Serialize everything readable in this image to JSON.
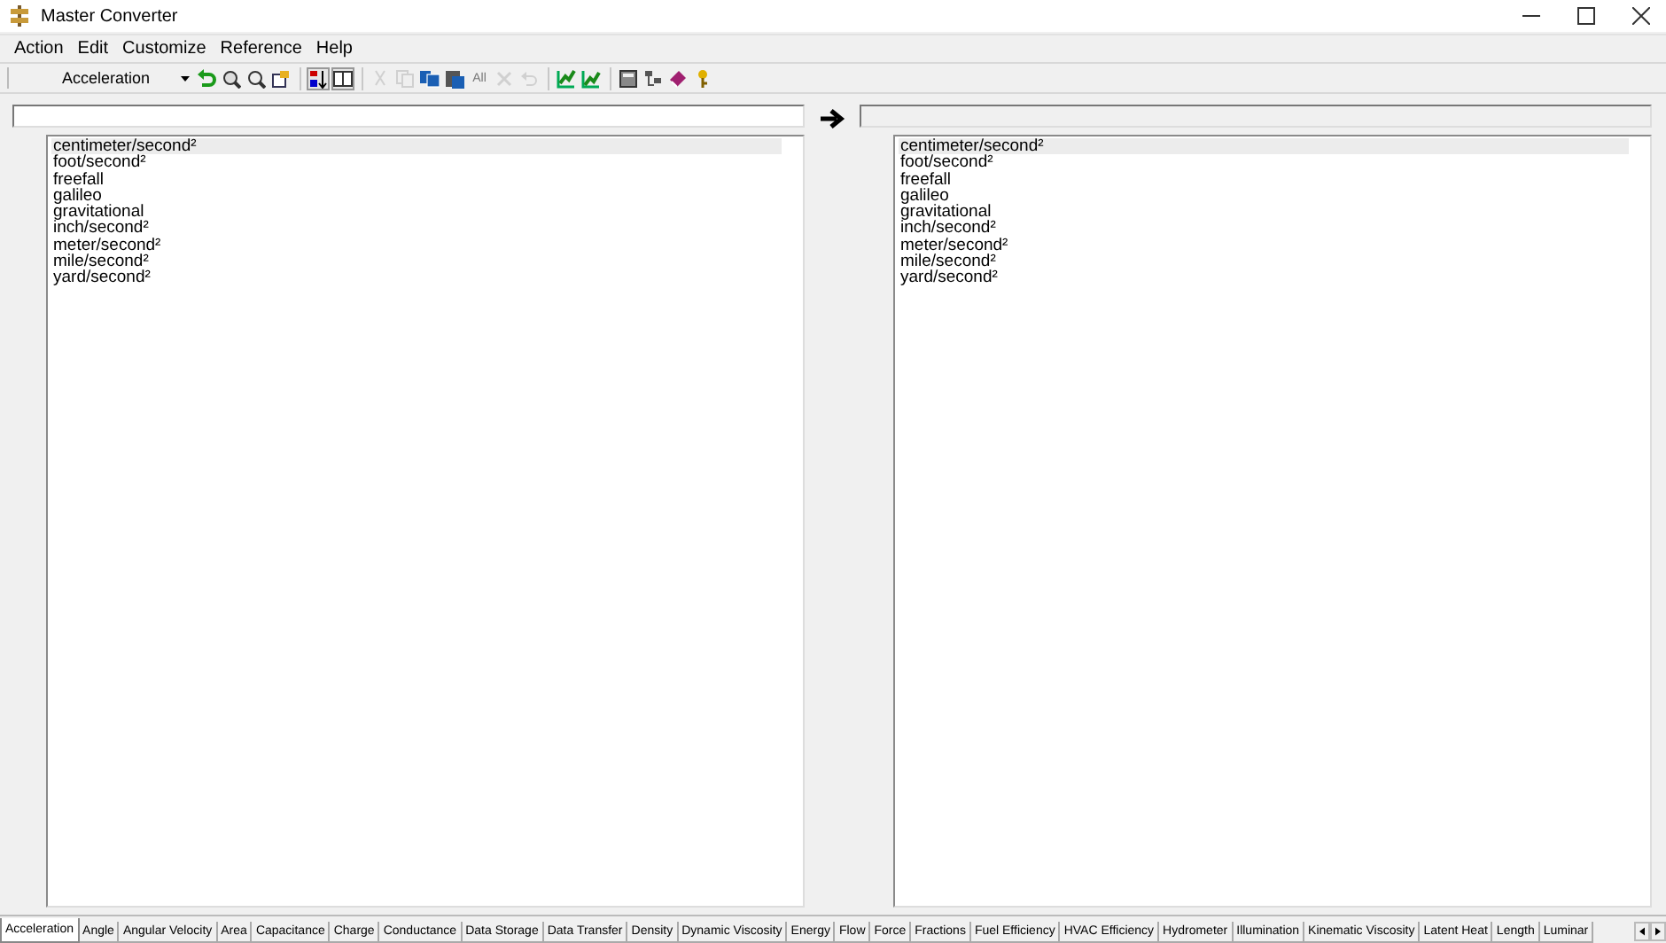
{
  "window": {
    "title": "Master Converter"
  },
  "menu": [
    "Action",
    "Edit",
    "Customize",
    "Reference",
    "Help"
  ],
  "toolbar": {
    "category": "Acceleration",
    "buttons": [
      {
        "disabled": false
      },
      {
        "disabled": false
      },
      {
        "disabled": false
      },
      {
        "disabled": false
      },
      {
        "disabled": false
      },
      {
        "disabled": false
      },
      {
        "disabled": true
      },
      {
        "disabled": true
      },
      {
        "disabled": false
      },
      {
        "disabled": false
      },
      {
        "label": "All",
        "disabled": true
      },
      {
        "disabled": true
      },
      {
        "disabled": true
      },
      {
        "disabled": false
      },
      {
        "disabled": false
      },
      {
        "disabled": false
      },
      {
        "disabled": false
      },
      {
        "disabled": false
      },
      {
        "disabled": false
      }
    ]
  },
  "from": {
    "disabled": false,
    "units": [
      {
        "label": "centimeter/second²",
        "selected": true
      },
      {
        "label": "foot/second²",
        "selected": false
      },
      {
        "label": "freefall",
        "selected": false
      },
      {
        "label": "galileo",
        "selected": false
      },
      {
        "label": "gravitational",
        "selected": false
      },
      {
        "label": "inch/second²",
        "selected": false
      },
      {
        "label": "meter/second²",
        "selected": false
      },
      {
        "label": "mile/second²",
        "selected": false
      },
      {
        "label": "yard/second²",
        "selected": false
      }
    ]
  },
  "to": {
    "disabled": true,
    "units": [
      {
        "label": "centimeter/second²",
        "selected": true
      },
      {
        "label": "foot/second²",
        "selected": false
      },
      {
        "label": "freefall",
        "selected": false
      },
      {
        "label": "galileo",
        "selected": false
      },
      {
        "label": "gravitational",
        "selected": false
      },
      {
        "label": "inch/second²",
        "selected": false
      },
      {
        "label": "meter/second²",
        "selected": false
      },
      {
        "label": "mile/second²",
        "selected": false
      },
      {
        "label": "yard/second²",
        "selected": false
      }
    ]
  },
  "tabs": [
    {
      "label": "Acceleration",
      "selected": true
    },
    {
      "label": "Angle",
      "selected": false
    },
    {
      "label": "Angular Velocity",
      "selected": false
    },
    {
      "label": "Area",
      "selected": false
    },
    {
      "label": "Capacitance",
      "selected": false
    },
    {
      "label": "Charge",
      "selected": false
    },
    {
      "label": "Conductance",
      "selected": false
    },
    {
      "label": "Data Storage",
      "selected": false
    },
    {
      "label": "Data Transfer",
      "selected": false
    },
    {
      "label": "Density",
      "selected": false
    },
    {
      "label": "Dynamic Viscosity",
      "selected": false
    },
    {
      "label": "Energy",
      "selected": false
    },
    {
      "label": "Flow",
      "selected": false
    },
    {
      "label": "Force",
      "selected": false
    },
    {
      "label": "Fractions",
      "selected": false
    },
    {
      "label": "Fuel Efficiency",
      "selected": false
    },
    {
      "label": "HVAC Efficiency",
      "selected": false
    },
    {
      "label": "Hydrometer",
      "selected": false
    },
    {
      "label": "Illumination",
      "selected": false
    },
    {
      "label": "Kinematic Viscosity",
      "selected": false
    },
    {
      "label": "Latent Heat",
      "selected": false
    },
    {
      "label": "Length",
      "selected": false
    },
    {
      "label": "Luminar",
      "selected": false
    }
  ]
}
